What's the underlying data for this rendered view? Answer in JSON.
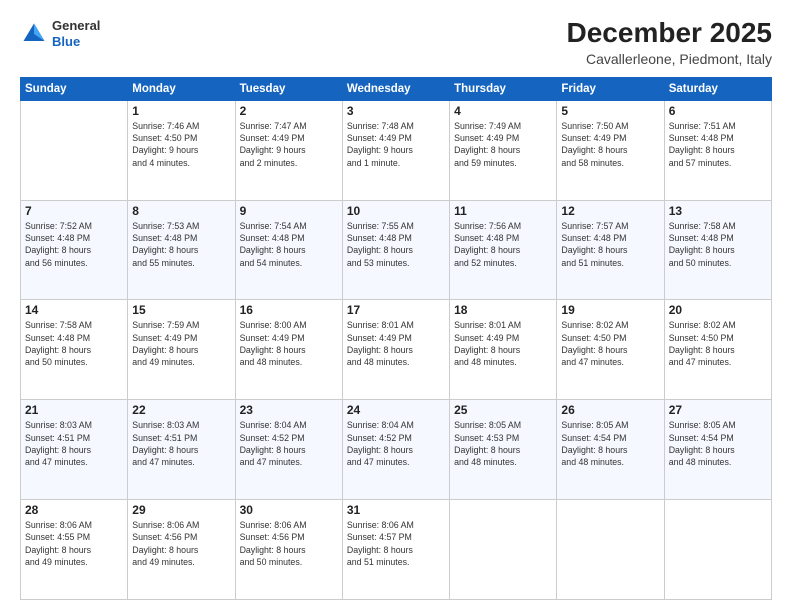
{
  "logo": {
    "text_general": "General",
    "text_blue": "Blue"
  },
  "header": {
    "month": "December 2025",
    "location": "Cavallerleone, Piedmont, Italy"
  },
  "weekdays": [
    "Sunday",
    "Monday",
    "Tuesday",
    "Wednesday",
    "Thursday",
    "Friday",
    "Saturday"
  ],
  "weeks": [
    [
      {
        "day": "",
        "info": ""
      },
      {
        "day": "1",
        "info": "Sunrise: 7:46 AM\nSunset: 4:50 PM\nDaylight: 9 hours\nand 4 minutes."
      },
      {
        "day": "2",
        "info": "Sunrise: 7:47 AM\nSunset: 4:49 PM\nDaylight: 9 hours\nand 2 minutes."
      },
      {
        "day": "3",
        "info": "Sunrise: 7:48 AM\nSunset: 4:49 PM\nDaylight: 9 hours\nand 1 minute."
      },
      {
        "day": "4",
        "info": "Sunrise: 7:49 AM\nSunset: 4:49 PM\nDaylight: 8 hours\nand 59 minutes."
      },
      {
        "day": "5",
        "info": "Sunrise: 7:50 AM\nSunset: 4:49 PM\nDaylight: 8 hours\nand 58 minutes."
      },
      {
        "day": "6",
        "info": "Sunrise: 7:51 AM\nSunset: 4:48 PM\nDaylight: 8 hours\nand 57 minutes."
      }
    ],
    [
      {
        "day": "7",
        "info": "Sunrise: 7:52 AM\nSunset: 4:48 PM\nDaylight: 8 hours\nand 56 minutes."
      },
      {
        "day": "8",
        "info": "Sunrise: 7:53 AM\nSunset: 4:48 PM\nDaylight: 8 hours\nand 55 minutes."
      },
      {
        "day": "9",
        "info": "Sunrise: 7:54 AM\nSunset: 4:48 PM\nDaylight: 8 hours\nand 54 minutes."
      },
      {
        "day": "10",
        "info": "Sunrise: 7:55 AM\nSunset: 4:48 PM\nDaylight: 8 hours\nand 53 minutes."
      },
      {
        "day": "11",
        "info": "Sunrise: 7:56 AM\nSunset: 4:48 PM\nDaylight: 8 hours\nand 52 minutes."
      },
      {
        "day": "12",
        "info": "Sunrise: 7:57 AM\nSunset: 4:48 PM\nDaylight: 8 hours\nand 51 minutes."
      },
      {
        "day": "13",
        "info": "Sunrise: 7:58 AM\nSunset: 4:48 PM\nDaylight: 8 hours\nand 50 minutes."
      }
    ],
    [
      {
        "day": "14",
        "info": "Sunrise: 7:58 AM\nSunset: 4:48 PM\nDaylight: 8 hours\nand 50 minutes."
      },
      {
        "day": "15",
        "info": "Sunrise: 7:59 AM\nSunset: 4:49 PM\nDaylight: 8 hours\nand 49 minutes."
      },
      {
        "day": "16",
        "info": "Sunrise: 8:00 AM\nSunset: 4:49 PM\nDaylight: 8 hours\nand 48 minutes."
      },
      {
        "day": "17",
        "info": "Sunrise: 8:01 AM\nSunset: 4:49 PM\nDaylight: 8 hours\nand 48 minutes."
      },
      {
        "day": "18",
        "info": "Sunrise: 8:01 AM\nSunset: 4:49 PM\nDaylight: 8 hours\nand 48 minutes."
      },
      {
        "day": "19",
        "info": "Sunrise: 8:02 AM\nSunset: 4:50 PM\nDaylight: 8 hours\nand 47 minutes."
      },
      {
        "day": "20",
        "info": "Sunrise: 8:02 AM\nSunset: 4:50 PM\nDaylight: 8 hours\nand 47 minutes."
      }
    ],
    [
      {
        "day": "21",
        "info": "Sunrise: 8:03 AM\nSunset: 4:51 PM\nDaylight: 8 hours\nand 47 minutes."
      },
      {
        "day": "22",
        "info": "Sunrise: 8:03 AM\nSunset: 4:51 PM\nDaylight: 8 hours\nand 47 minutes."
      },
      {
        "day": "23",
        "info": "Sunrise: 8:04 AM\nSunset: 4:52 PM\nDaylight: 8 hours\nand 47 minutes."
      },
      {
        "day": "24",
        "info": "Sunrise: 8:04 AM\nSunset: 4:52 PM\nDaylight: 8 hours\nand 47 minutes."
      },
      {
        "day": "25",
        "info": "Sunrise: 8:05 AM\nSunset: 4:53 PM\nDaylight: 8 hours\nand 48 minutes."
      },
      {
        "day": "26",
        "info": "Sunrise: 8:05 AM\nSunset: 4:54 PM\nDaylight: 8 hours\nand 48 minutes."
      },
      {
        "day": "27",
        "info": "Sunrise: 8:05 AM\nSunset: 4:54 PM\nDaylight: 8 hours\nand 48 minutes."
      }
    ],
    [
      {
        "day": "28",
        "info": "Sunrise: 8:06 AM\nSunset: 4:55 PM\nDaylight: 8 hours\nand 49 minutes."
      },
      {
        "day": "29",
        "info": "Sunrise: 8:06 AM\nSunset: 4:56 PM\nDaylight: 8 hours\nand 49 minutes."
      },
      {
        "day": "30",
        "info": "Sunrise: 8:06 AM\nSunset: 4:56 PM\nDaylight: 8 hours\nand 50 minutes."
      },
      {
        "day": "31",
        "info": "Sunrise: 8:06 AM\nSunset: 4:57 PM\nDaylight: 8 hours\nand 51 minutes."
      },
      {
        "day": "",
        "info": ""
      },
      {
        "day": "",
        "info": ""
      },
      {
        "day": "",
        "info": ""
      }
    ]
  ]
}
